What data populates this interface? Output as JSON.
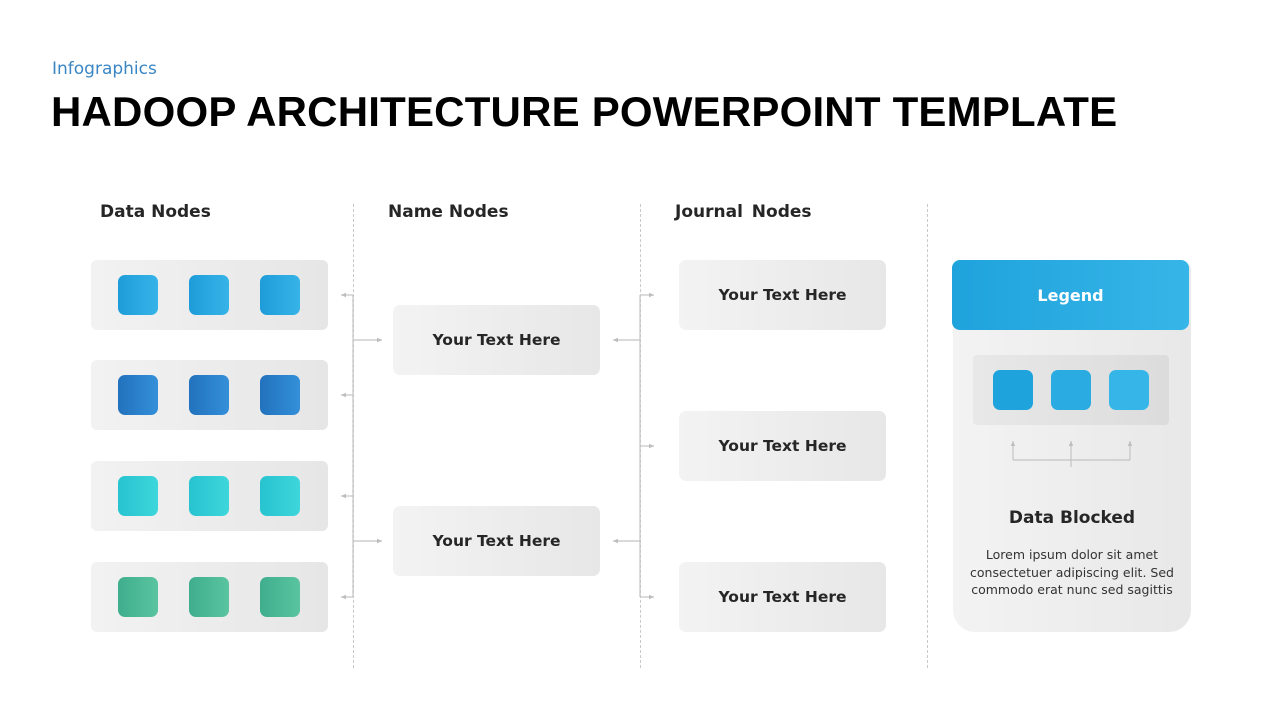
{
  "header": {
    "subtitle": "Infographics",
    "title": "HADOOP ARCHITECTURE POWERPOINT TEMPLATE"
  },
  "columns": {
    "data_nodes": "Data Nodes",
    "name_nodes": "Name Nodes",
    "journal_nodes": "Journal Nodes"
  },
  "data_node_rows": [
    {
      "color_from": "#1e9cd9",
      "color_to": "#36b4e8",
      "blocks": 3
    },
    {
      "color_from": "#2272bd",
      "color_to": "#348fd9",
      "blocks": 3
    },
    {
      "color_from": "#27c3d0",
      "color_to": "#3dd6db",
      "blocks": 3
    },
    {
      "color_from": "#3fae8c",
      "color_to": "#5ac4a0",
      "blocks": 3
    }
  ],
  "name_nodes": [
    {
      "label": "Your Text Here"
    },
    {
      "label": "Your Text Here"
    }
  ],
  "journal_nodes": [
    {
      "label": "Your Text Here"
    },
    {
      "label": "Your Text Here"
    },
    {
      "label": "Your Text Here"
    }
  ],
  "legend": {
    "header": "Legend",
    "block_colors": [
      "#1fa3dc",
      "#2aabe2",
      "#36b5e8"
    ],
    "title": "Data Blocked",
    "body": "Lorem ipsum dolor sit amet consectetuer adipiscing elit. Sed commodo erat nunc sed sagittis"
  },
  "colors": {
    "accent_blue": "#1fa3dc",
    "subtitle_blue": "#3a86c4",
    "connector_gray": "#bdbdbd"
  }
}
